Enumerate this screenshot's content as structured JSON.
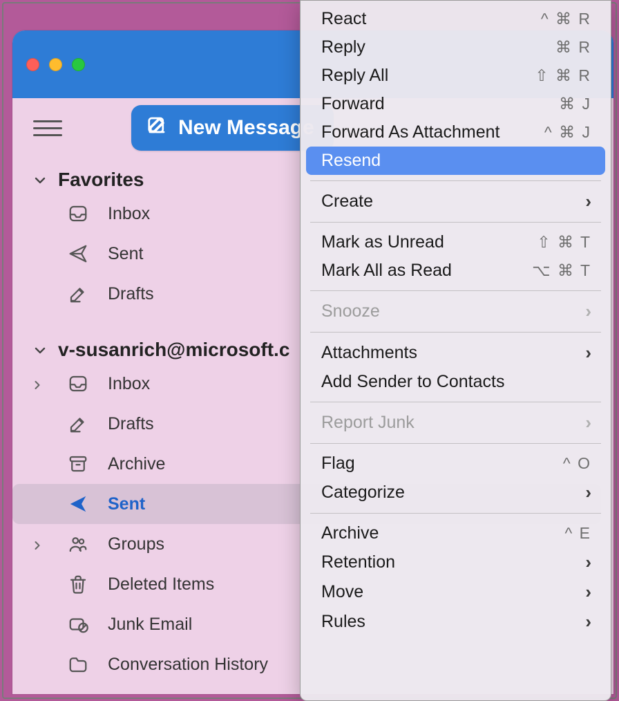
{
  "toolbar": {
    "new_message": "New Message"
  },
  "sidebar": {
    "favorites_label": "Favorites",
    "favorites": [
      {
        "label": "Inbox",
        "icon": "inbox-icon"
      },
      {
        "label": "Sent",
        "icon": "send-icon"
      },
      {
        "label": "Drafts",
        "icon": "drafts-icon"
      }
    ],
    "account_label": "v-susanrich@microsoft.c",
    "folders": [
      {
        "label": "Inbox",
        "icon": "inbox-icon",
        "expandable": true
      },
      {
        "label": "Drafts",
        "icon": "drafts-icon"
      },
      {
        "label": "Archive",
        "icon": "archive-icon"
      },
      {
        "label": "Sent",
        "icon": "send-icon",
        "selected": true
      },
      {
        "label": "Groups",
        "icon": "groups-icon",
        "expandable": true
      },
      {
        "label": "Deleted Items",
        "icon": "trash-icon"
      },
      {
        "label": "Junk Email",
        "icon": "junk-icon"
      },
      {
        "label": "Conversation History",
        "icon": "folder-icon"
      }
    ]
  },
  "context_menu": {
    "items": [
      {
        "label": "React",
        "shortcut": "^ ⌘ R"
      },
      {
        "label": "Reply",
        "shortcut": "⌘ R"
      },
      {
        "label": "Reply All",
        "shortcut": "⇧ ⌘ R"
      },
      {
        "label": "Forward",
        "shortcut": "⌘ J"
      },
      {
        "label": "Forward As Attachment",
        "shortcut": "^ ⌘ J"
      },
      {
        "label": "Resend",
        "highlight": true
      },
      {
        "sep": true
      },
      {
        "label": "Create",
        "submenu": true
      },
      {
        "sep": true
      },
      {
        "label": "Mark as Unread",
        "shortcut": "⇧ ⌘ T"
      },
      {
        "label": "Mark All as Read",
        "shortcut": "⌥ ⌘ T"
      },
      {
        "sep": true
      },
      {
        "label": "Snooze",
        "submenu": true,
        "disabled": true
      },
      {
        "sep": true
      },
      {
        "label": "Attachments",
        "submenu": true
      },
      {
        "label": "Add Sender to Contacts"
      },
      {
        "sep": true
      },
      {
        "label": "Report Junk",
        "submenu": true,
        "disabled": true
      },
      {
        "sep": true
      },
      {
        "label": "Flag",
        "shortcut": "^ O"
      },
      {
        "label": "Categorize",
        "submenu": true
      },
      {
        "sep": true
      },
      {
        "label": "Archive",
        "shortcut": "^ E"
      },
      {
        "label": "Retention",
        "submenu": true
      },
      {
        "label": "Move",
        "submenu": true
      },
      {
        "label": "Rules",
        "submenu": true
      }
    ]
  }
}
